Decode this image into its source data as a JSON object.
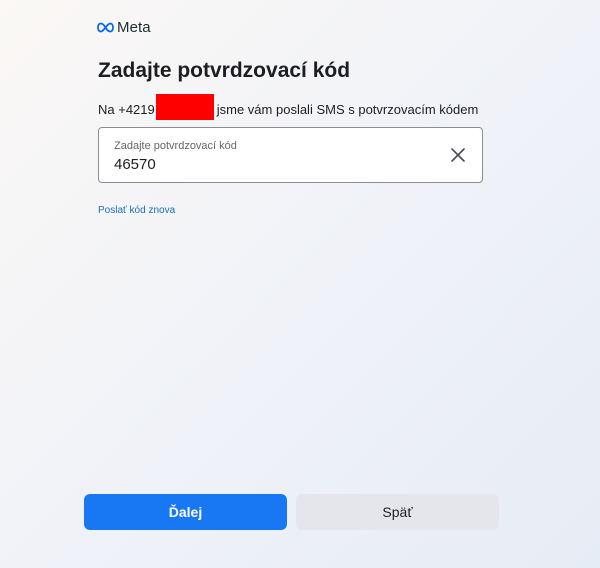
{
  "brand": {
    "logo_icon": "meta-infinity-icon",
    "name": "Meta",
    "accent_color": "#1877f2"
  },
  "title": "Zadajte potvrdzovací kód",
  "subtitle": {
    "prefix": "Na +4219",
    "suffix": "jsme vám poslali SMS s potvrzovacím kódem"
  },
  "code_field": {
    "label": "Zadajte potvrdzovací kód",
    "value": "46570",
    "clear_icon": "close-icon"
  },
  "resend_link": "Poslať kód znova",
  "buttons": {
    "next": "Ďalej",
    "back": "Späť"
  }
}
